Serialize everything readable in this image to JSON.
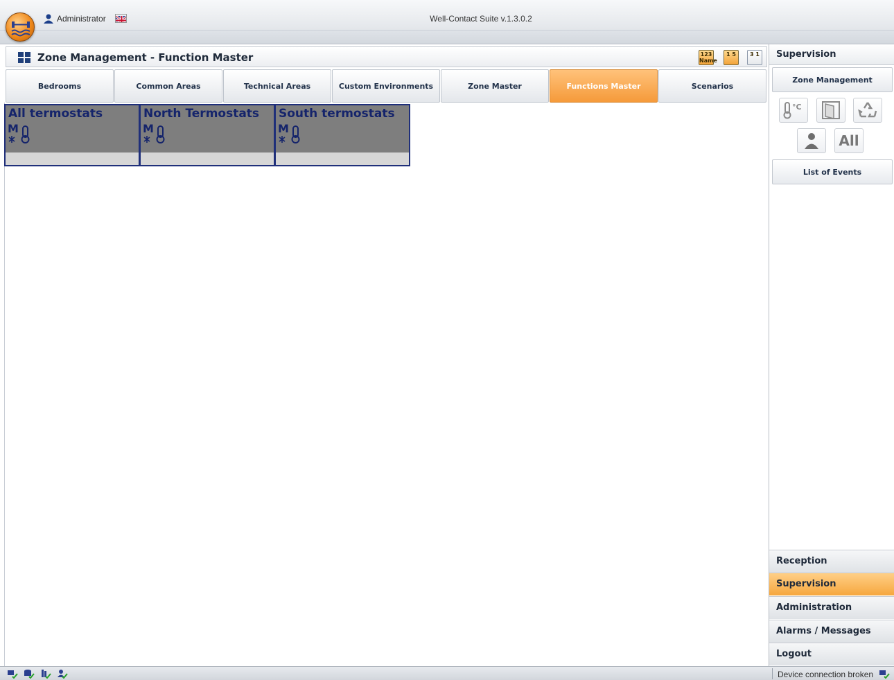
{
  "window": {
    "title": "Well-Contact Suite v.1.3.0.2",
    "user": "Administrator"
  },
  "panel": {
    "title": "Zone Management - Function Master",
    "sort_buttons": [
      {
        "label": "123 Name"
      },
      {
        "label": "1 5"
      },
      {
        "label": "3 1"
      }
    ]
  },
  "tabs": [
    {
      "label": "Bedrooms",
      "active": false
    },
    {
      "label": "Common Areas",
      "active": false
    },
    {
      "label": "Technical Areas",
      "active": false
    },
    {
      "label": "Custom Environments",
      "active": false
    },
    {
      "label": "Zone Master",
      "active": false
    },
    {
      "label": "Functions Master",
      "active": true
    },
    {
      "label": "Scenarios",
      "active": false
    }
  ],
  "zones": [
    {
      "name": "All termostats",
      "icon": "master-thermostat-icon"
    },
    {
      "name": "North Termostats",
      "icon": "master-thermostat-icon"
    },
    {
      "name": "South termostats",
      "icon": "master-thermostat-icon"
    }
  ],
  "sidebar": {
    "header": "Supervision",
    "zone_management": "Zone Management",
    "filters": [
      {
        "icon": "thermometer-celsius-icon",
        "label": "°C"
      },
      {
        "icon": "door-icon",
        "label": ""
      },
      {
        "icon": "recycle-icon",
        "label": ""
      },
      {
        "icon": "person-icon",
        "label": ""
      },
      {
        "icon": "all-icon",
        "label": "All"
      }
    ],
    "list_of_events": "List of Events",
    "nav": [
      {
        "label": "Reception",
        "active": false
      },
      {
        "label": "Supervision",
        "active": true
      },
      {
        "label": "Administration",
        "active": false
      },
      {
        "label": "Alarms / Messages",
        "active": false
      },
      {
        "label": "Logout",
        "active": false
      }
    ]
  },
  "status": {
    "text": "Device connection broken",
    "icons": [
      "network-ok-icon",
      "database-ok-icon",
      "device-ok-icon",
      "user-ok-icon"
    ]
  },
  "colors": {
    "accent": "#f59a3a",
    "card_border": "#1f2f7a",
    "card_title": "#15246b"
  }
}
